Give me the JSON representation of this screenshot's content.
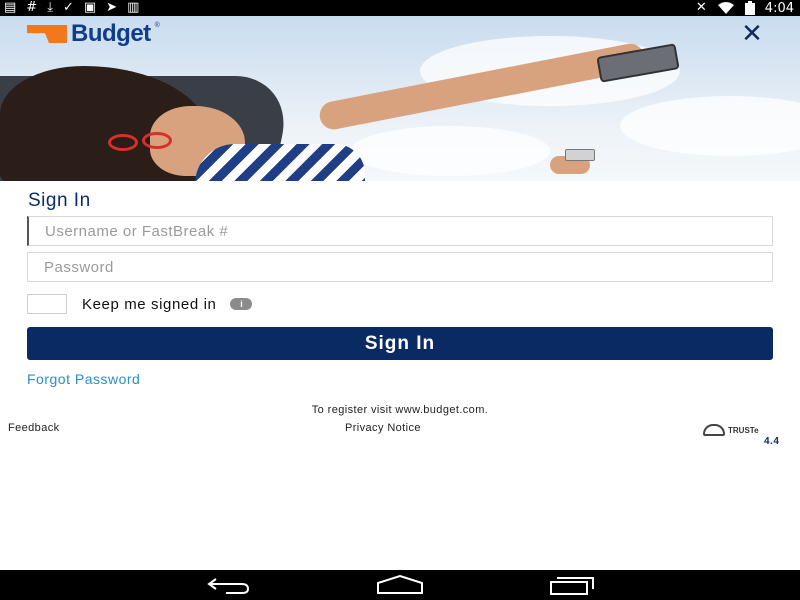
{
  "status_bar": {
    "left_icons": [
      "message-icon",
      "hash-icon",
      "download-icon",
      "check-icon",
      "photo-icon",
      "send-icon",
      "barcode-icon"
    ],
    "right_icons": [
      "mute-icon",
      "wifi-icon",
      "battery-icon"
    ],
    "time": "4:04"
  },
  "header": {
    "brand": "Budget",
    "close_icon": "close-icon"
  },
  "form": {
    "title": "Sign In",
    "username_placeholder": "Username or FastBreak #",
    "password_placeholder": "Password",
    "keep_signed_in_label": "Keep me signed in",
    "info_badge": "i",
    "submit_label": "Sign In",
    "forgot_password": "Forgot Password"
  },
  "footer": {
    "register_text": "To register visit www.budget.com.",
    "feedback": "Feedback",
    "privacy": "Privacy Notice",
    "truste": "TRUSTe",
    "version": "4.4"
  },
  "nav_bar": {
    "icons": [
      "back-icon",
      "home-icon",
      "recent-apps-icon"
    ]
  },
  "colors": {
    "brand_blue": "#0a2a63",
    "brand_orange": "#f0781e",
    "link_blue": "#2a8fc9"
  }
}
